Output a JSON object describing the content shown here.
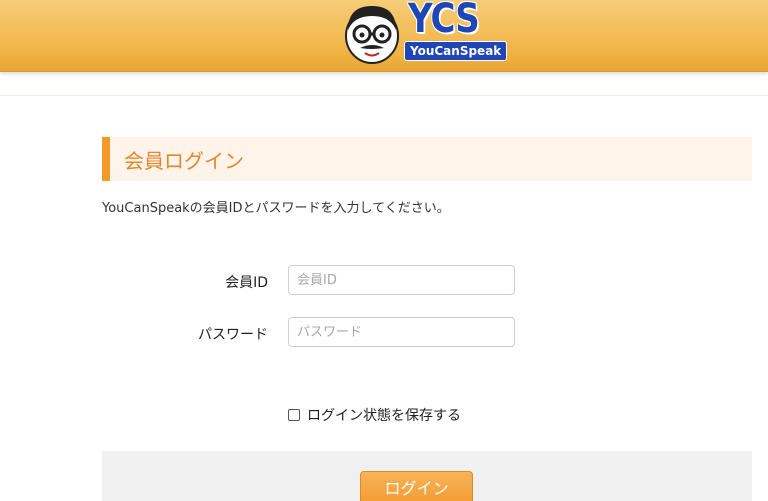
{
  "header": {
    "logo_text": "YCS",
    "logo_sub": "YouCanSpeak"
  },
  "section": {
    "title": "会員ログイン",
    "intro": "YouCanSpeakの会員IDとパスワードを入力してください。"
  },
  "form": {
    "member_id_label": "会員ID",
    "member_id_placeholder": "会員ID",
    "password_label": "パスワード",
    "password_placeholder": "パスワード",
    "remember_label": "ログイン状態を保存する",
    "remember_checked": false,
    "login_button": "ログイン"
  },
  "colors": {
    "header": "#f0b548",
    "accent": "#f39a2b",
    "logo_blue": "#1e46b4"
  }
}
